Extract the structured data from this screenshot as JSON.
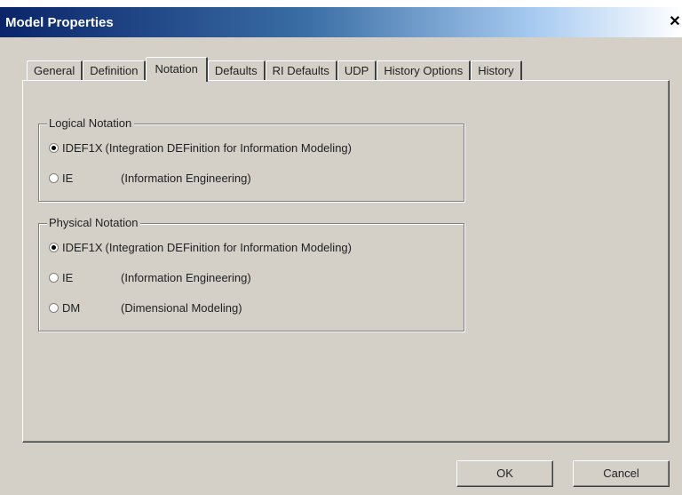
{
  "window": {
    "title": "Model Properties",
    "close_glyph": "✕"
  },
  "tabs": [
    {
      "label": "General",
      "active": false
    },
    {
      "label": "Definition",
      "active": false
    },
    {
      "label": "Notation",
      "active": true
    },
    {
      "label": "Defaults",
      "active": false
    },
    {
      "label": "RI Defaults",
      "active": false
    },
    {
      "label": "UDP",
      "active": false
    },
    {
      "label": "History Options",
      "active": false
    },
    {
      "label": "History",
      "active": false
    }
  ],
  "logical_notation": {
    "label": "Logical Notation",
    "options": [
      {
        "code": "IDEF1X",
        "description": "(Integration DEFinition for Information Modeling)",
        "selected": true
      },
      {
        "code": "IE",
        "description": "(Information Engineering)",
        "selected": false
      }
    ]
  },
  "physical_notation": {
    "label": "Physical Notation",
    "options": [
      {
        "code": "IDEF1X",
        "description": "(Integration DEFinition for Information Modeling)",
        "selected": true
      },
      {
        "code": "IE",
        "description": "(Information Engineering)",
        "selected": false
      },
      {
        "code": "DM",
        "description": "(Dimensional Modeling)",
        "selected": false
      }
    ]
  },
  "buttons": {
    "ok": "OK",
    "cancel": "Cancel"
  }
}
